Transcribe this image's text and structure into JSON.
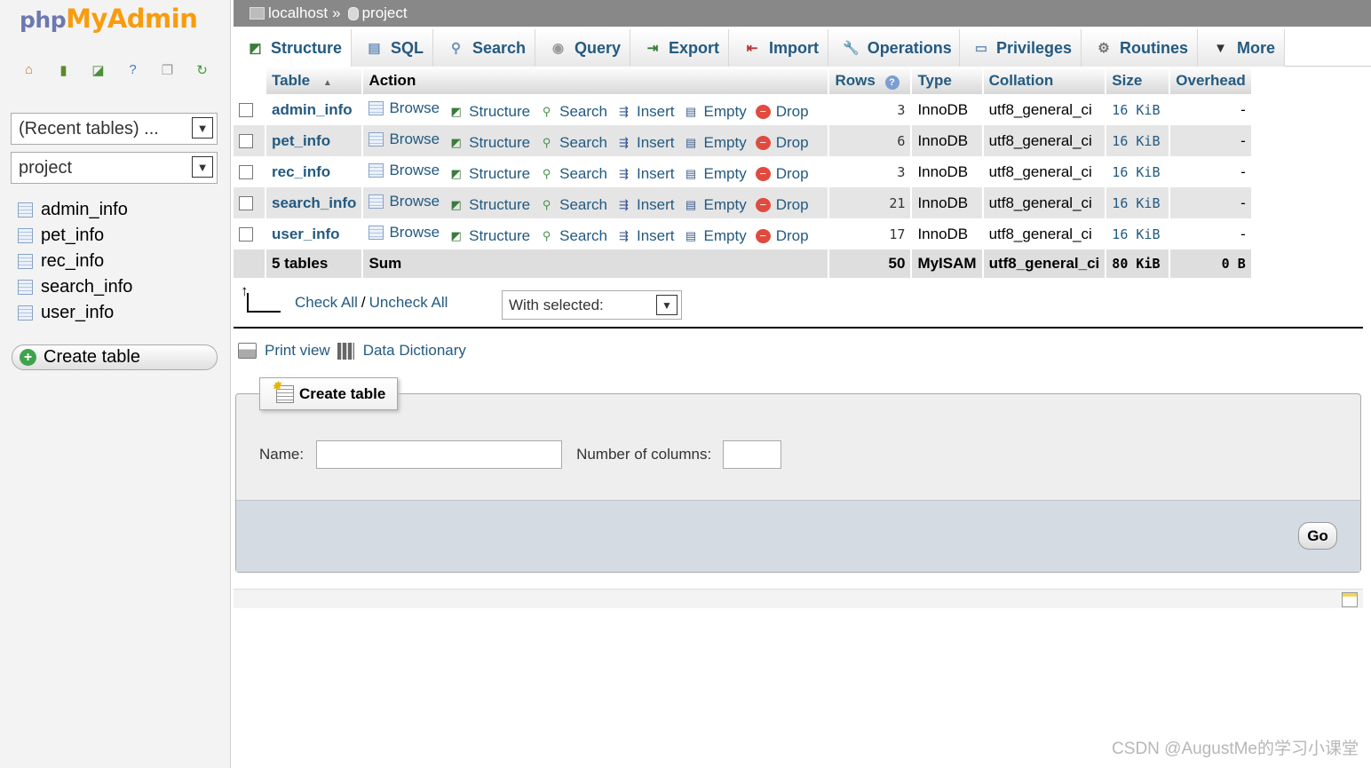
{
  "logo": {
    "part1": "php",
    "part2": "MyAdmin"
  },
  "nav": {
    "recent": "(Recent tables) ...",
    "database": "project",
    "tables": [
      "admin_info",
      "pet_info",
      "rec_info",
      "search_info",
      "user_info"
    ],
    "create_table": "Create table"
  },
  "breadcrumb": {
    "server": "localhost",
    "sep": "»",
    "db": "project"
  },
  "tabs": [
    "Structure",
    "SQL",
    "Search",
    "Query",
    "Export",
    "Import",
    "Operations",
    "Privileges",
    "Routines",
    "More"
  ],
  "table": {
    "headers": {
      "table": "Table",
      "action": "Action",
      "rows": "Rows",
      "type": "Type",
      "collation": "Collation",
      "size": "Size",
      "overhead": "Overhead"
    },
    "actions": [
      "Browse",
      "Structure",
      "Search",
      "Insert",
      "Empty",
      "Drop"
    ],
    "rows": [
      {
        "name": "admin_info",
        "rows": "3",
        "type": "InnoDB",
        "collation": "utf8_general_ci",
        "size": "16 KiB",
        "overhead": "-"
      },
      {
        "name": "pet_info",
        "rows": "6",
        "type": "InnoDB",
        "collation": "utf8_general_ci",
        "size": "16 KiB",
        "overhead": "-"
      },
      {
        "name": "rec_info",
        "rows": "3",
        "type": "InnoDB",
        "collation": "utf8_general_ci",
        "size": "16 KiB",
        "overhead": "-"
      },
      {
        "name": "search_info",
        "rows": "21",
        "type": "InnoDB",
        "collation": "utf8_general_ci",
        "size": "16 KiB",
        "overhead": "-"
      },
      {
        "name": "user_info",
        "rows": "17",
        "type": "InnoDB",
        "collation": "utf8_general_ci",
        "size": "16 KiB",
        "overhead": "-"
      }
    ],
    "footer": {
      "count": "5 tables",
      "sum": "Sum",
      "rows": "50",
      "type": "MyISAM",
      "collation": "utf8_general_ci",
      "size": "80 KiB",
      "overhead": "0 B"
    }
  },
  "bulk": {
    "check_all": "Check All",
    "slash": "/",
    "uncheck_all": "Uncheck All",
    "with_selected": "With selected:"
  },
  "links": {
    "print_view": "Print view",
    "data_dictionary": "Data Dictionary"
  },
  "create_form": {
    "legend": "Create table",
    "name_label": "Name:",
    "columns_label": "Number of columns:",
    "name_value": "",
    "columns_value": "",
    "go": "Go"
  },
  "watermark": "CSDN @AugustMe的学习小课堂"
}
